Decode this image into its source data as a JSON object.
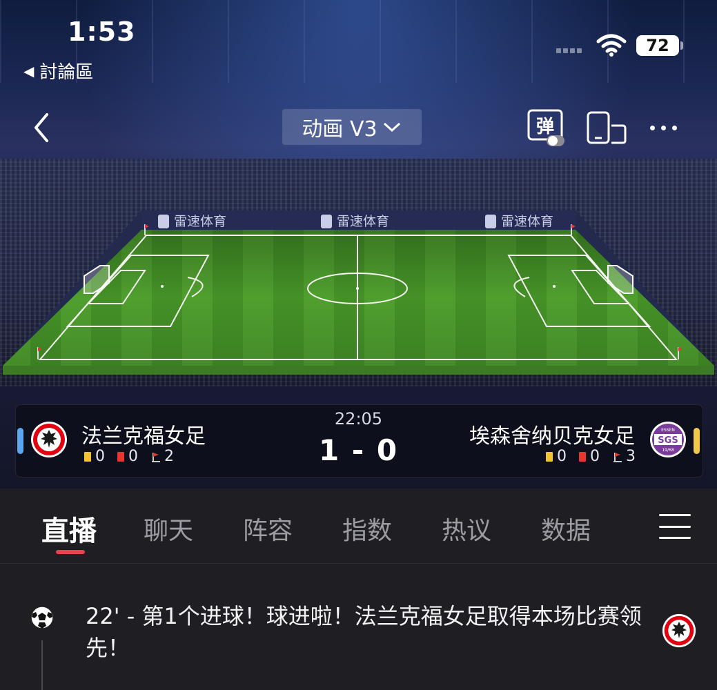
{
  "status_bar": {
    "time": "1:53",
    "back_app_label": "討論區",
    "battery": "72"
  },
  "nav": {
    "version_label": "动画 V3",
    "danmaku_label": "弹"
  },
  "stadium": {
    "ad_board_text": "雷速体育",
    "pitch_color": "#4a9a2c"
  },
  "match": {
    "clock": "22:05",
    "score": "1 - 0",
    "home": {
      "name": "法兰克福女足",
      "yellow_cards": "0",
      "red_cards": "0",
      "corners": "2",
      "side_color": "#5aa7f0"
    },
    "away": {
      "name": "埃森舍纳贝克女足",
      "badge_top": "ESSEN",
      "badge_text": "SGS",
      "badge_bottom": "19/68",
      "yellow_cards": "0",
      "red_cards": "0",
      "corners": "3",
      "side_color": "#f1c84b"
    }
  },
  "tabs": [
    {
      "label": "直播",
      "active": true
    },
    {
      "label": "聊天",
      "active": false
    },
    {
      "label": "阵容",
      "active": false
    },
    {
      "label": "指数",
      "active": false
    },
    {
      "label": "热议",
      "active": false
    },
    {
      "label": "数据",
      "active": false
    }
  ],
  "feed": [
    {
      "icon": "soccer-ball-icon",
      "text": "22' - 第1个进球！球进啦！法兰克福女足取得本场比赛领先！",
      "team_badge": "eintracht-badge-icon"
    }
  ],
  "colors": {
    "tab_indicator": "#e9414f",
    "background": "#1f1f23"
  }
}
